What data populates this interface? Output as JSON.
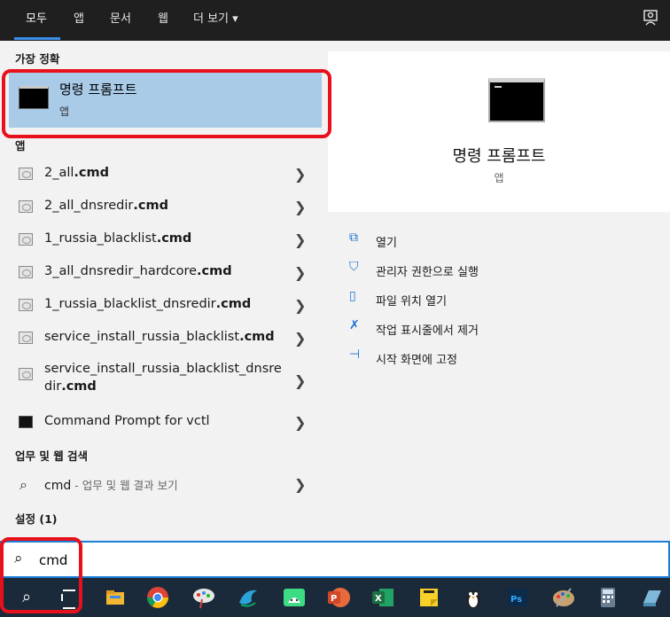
{
  "tabs": [
    {
      "label": "모두"
    },
    {
      "label": "앱"
    },
    {
      "label": "문서"
    },
    {
      "label": "웹"
    },
    {
      "label": "더 보기 ▾"
    }
  ],
  "left": {
    "best_match_header": "가장 정확",
    "best_match": {
      "title": "명령 프롬프트",
      "subtitle": "앱"
    },
    "apps_header": "앱",
    "results": [
      {
        "name": "2_all",
        "ext": ".cmd"
      },
      {
        "name": "2_all_dnsredir",
        "ext": ".cmd"
      },
      {
        "name": "1_russia_blacklist",
        "ext": ".cmd"
      },
      {
        "name": "3_all_dnsredir_hardcore",
        "ext": ".cmd"
      },
      {
        "name": "1_russia_blacklist_dnsredir",
        "ext": ".cmd"
      },
      {
        "name": "service_install_russia_blacklist",
        "ext": ".cmd"
      },
      {
        "name": "service_install_russia_blacklist_dnsre dir",
        "ext": ".cmd"
      },
      {
        "name": "Command Prompt for vctl",
        "ext": ""
      }
    ],
    "web_header": "업무 및 웹 검색",
    "web_query": "cmd",
    "web_hint": " - 업무 및 웹 결과 보기",
    "settings_header": "설정 (1)"
  },
  "preview": {
    "title": "명령 프롬프트",
    "subtitle": "앱",
    "actions": [
      {
        "icon": "open-icon",
        "glyph": "⧉",
        "label": "열기"
      },
      {
        "icon": "shield-icon",
        "glyph": "⛉",
        "label": "관리자 권한으로 실행"
      },
      {
        "icon": "file-location-icon",
        "glyph": "▯",
        "label": "파일 위치 열기"
      },
      {
        "icon": "unpin-taskbar-icon",
        "glyph": "✗",
        "label": "작업 표시줄에서 제거"
      },
      {
        "icon": "pin-start-icon",
        "glyph": "⊣",
        "label": "시작 화면에 고정"
      }
    ]
  },
  "search": {
    "value": "cmd"
  },
  "taskbar": {
    "apps": [
      {
        "icon": "file-explorer-icon",
        "color": "#f2b632"
      },
      {
        "icon": "chrome-icon",
        "color": "#db4437"
      },
      {
        "icon": "paint-icon",
        "color": "#e6e6e6"
      },
      {
        "icon": "swift-icon",
        "color": "#2aa3d8"
      },
      {
        "icon": "android-studio-icon",
        "color": "#3ddc84"
      },
      {
        "icon": "powerpoint-icon",
        "color": "#d24726"
      },
      {
        "icon": "excel-icon",
        "color": "#1d7044"
      },
      {
        "icon": "sticky-notes-icon",
        "color": "#f7d02a"
      },
      {
        "icon": "penguin-icon",
        "color": "#ffffff"
      },
      {
        "icon": "photoshop-icon",
        "color": "#0b2b4a"
      },
      {
        "icon": "paint-palette-icon",
        "color": "#c8a070"
      },
      {
        "icon": "calculator-icon",
        "color": "#6a7d93"
      },
      {
        "icon": "app-icon",
        "color": "#7fb8d8"
      }
    ]
  },
  "colors": {
    "accent": "#1a7dd6",
    "selected": "#a9cbe8",
    "annotation": "#e8101b"
  }
}
